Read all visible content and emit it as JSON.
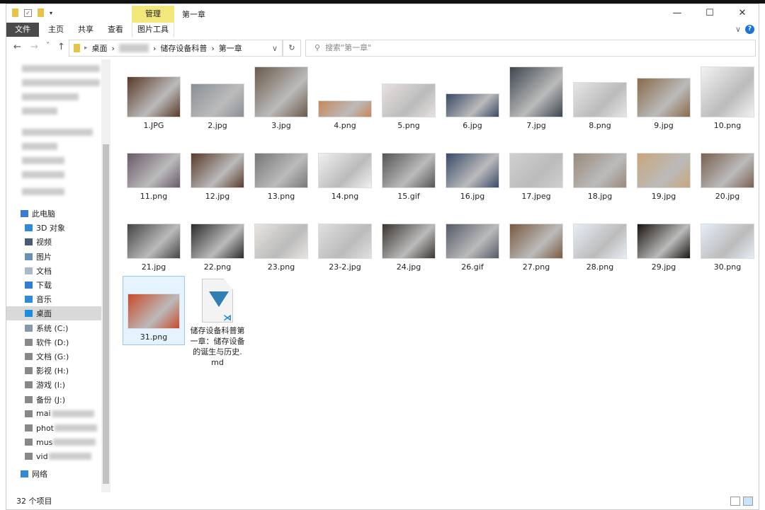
{
  "window": {
    "title": "第一章",
    "manage_tab": "管理",
    "minimize": "—",
    "maximize": "☐",
    "close": "✕"
  },
  "ribbon": {
    "tabs": [
      "文件",
      "主页",
      "共享",
      "查看",
      "图片工具"
    ],
    "expand": "∨",
    "help": "?"
  },
  "nav": {
    "back": "←",
    "forward": "→",
    "recent": "˅",
    "up": "↑",
    "refresh": "↻",
    "dropdown": "∨",
    "breadcrumb": [
      "桌面",
      "储存设备科普",
      "第一章"
    ],
    "separator": "›",
    "search_placeholder": "搜索\"第一章\""
  },
  "sidebar": {
    "items": [
      {
        "label": "此电脑",
        "icon": "computer-icon",
        "color": "#3a7bd5"
      },
      {
        "label": "3D 对象",
        "icon": "cube-icon",
        "color": "#2f8ad8"
      },
      {
        "label": "视频",
        "icon": "video-icon",
        "color": "#4a5b7a"
      },
      {
        "label": "图片",
        "icon": "pictures-icon",
        "color": "#6a8fb5"
      },
      {
        "label": "文档",
        "icon": "documents-icon",
        "color": "#aab8c8"
      },
      {
        "label": "下载",
        "icon": "download-icon",
        "color": "#2f7ed8"
      },
      {
        "label": "音乐",
        "icon": "music-icon",
        "color": "#2f8ad8"
      },
      {
        "label": "桌面",
        "icon": "desktop-icon",
        "color": "#1a8fe0"
      },
      {
        "label": "系统 (C:)",
        "icon": "drive-icon",
        "color": "#8899aa"
      },
      {
        "label": "软件 (D:)",
        "icon": "drive-icon",
        "color": "#888"
      },
      {
        "label": "文档 (G:)",
        "icon": "drive-icon",
        "color": "#888"
      },
      {
        "label": "影视 (H:)",
        "icon": "drive-icon",
        "color": "#888"
      },
      {
        "label": "游戏 (I:)",
        "icon": "drive-icon",
        "color": "#888"
      },
      {
        "label": "备份 (J:)",
        "icon": "drive-icon",
        "color": "#888"
      },
      {
        "label": "mai",
        "icon": "network-drive-icon",
        "color": "#888"
      },
      {
        "label": "phot",
        "icon": "network-drive-icon",
        "color": "#888"
      },
      {
        "label": "mus",
        "icon": "network-drive-icon",
        "color": "#888"
      },
      {
        "label": "vid",
        "icon": "network-drive-icon",
        "color": "#888"
      },
      {
        "label": "网络",
        "icon": "network-icon",
        "color": "#2f8ad8"
      }
    ],
    "selected": "桌面"
  },
  "files": [
    {
      "name": "1.JPG",
      "color": "#5a3a28"
    },
    {
      "name": "2.jpg",
      "color": "#8a8f96"
    },
    {
      "name": "3.jpg",
      "color": "#6b5a4a"
    },
    {
      "name": "4.png",
      "color": "#c8875a"
    },
    {
      "name": "5.png",
      "color": "#e8e0e0"
    },
    {
      "name": "6.jpg",
      "color": "#3a4a66"
    },
    {
      "name": "7.jpg",
      "color": "#3d4650"
    },
    {
      "name": "8.png",
      "color": "#e6e6e6"
    },
    {
      "name": "9.jpg",
      "color": "#8a6a4a"
    },
    {
      "name": "10.png",
      "color": "#f2f2f2"
    },
    {
      "name": "11.png",
      "color": "#6a5a6a"
    },
    {
      "name": "12.jpg",
      "color": "#5a3a2a"
    },
    {
      "name": "13.png",
      "color": "#777"
    },
    {
      "name": "14.png",
      "color": "#f0f0f0"
    },
    {
      "name": "15.gif",
      "color": "#555"
    },
    {
      "name": "16.jpg",
      "color": "#3a4a6a"
    },
    {
      "name": "17.jpeg",
      "color": "#d0d0d0"
    },
    {
      "name": "18.jpg",
      "color": "#9a8a7a"
    },
    {
      "name": "19.jpg",
      "color": "#c9a57a"
    },
    {
      "name": "20.jpg",
      "color": "#7a6050"
    },
    {
      "name": "21.jpg",
      "color": "#444"
    },
    {
      "name": "22.png",
      "color": "#2a2a2a"
    },
    {
      "name": "23.png",
      "color": "#e8e4e0"
    },
    {
      "name": "23-2.jpg",
      "color": "#e0e0e0"
    },
    {
      "name": "24.jpg",
      "color": "#3a3530"
    },
    {
      "name": "26.gif",
      "color": "#555a66"
    },
    {
      "name": "27.png",
      "color": "#7a5a40"
    },
    {
      "name": "28.png",
      "color": "#e8eef6"
    },
    {
      "name": "29.jpg",
      "color": "#1a1410"
    },
    {
      "name": "30.png",
      "color": "#e6eef8"
    },
    {
      "name": "31.png",
      "color": "#c84a2a"
    },
    {
      "name": "储存设备科普第一章：储存设备的诞生与历史.md",
      "color": "#2f7fb3"
    }
  ],
  "status": {
    "count": "32 个项目"
  }
}
